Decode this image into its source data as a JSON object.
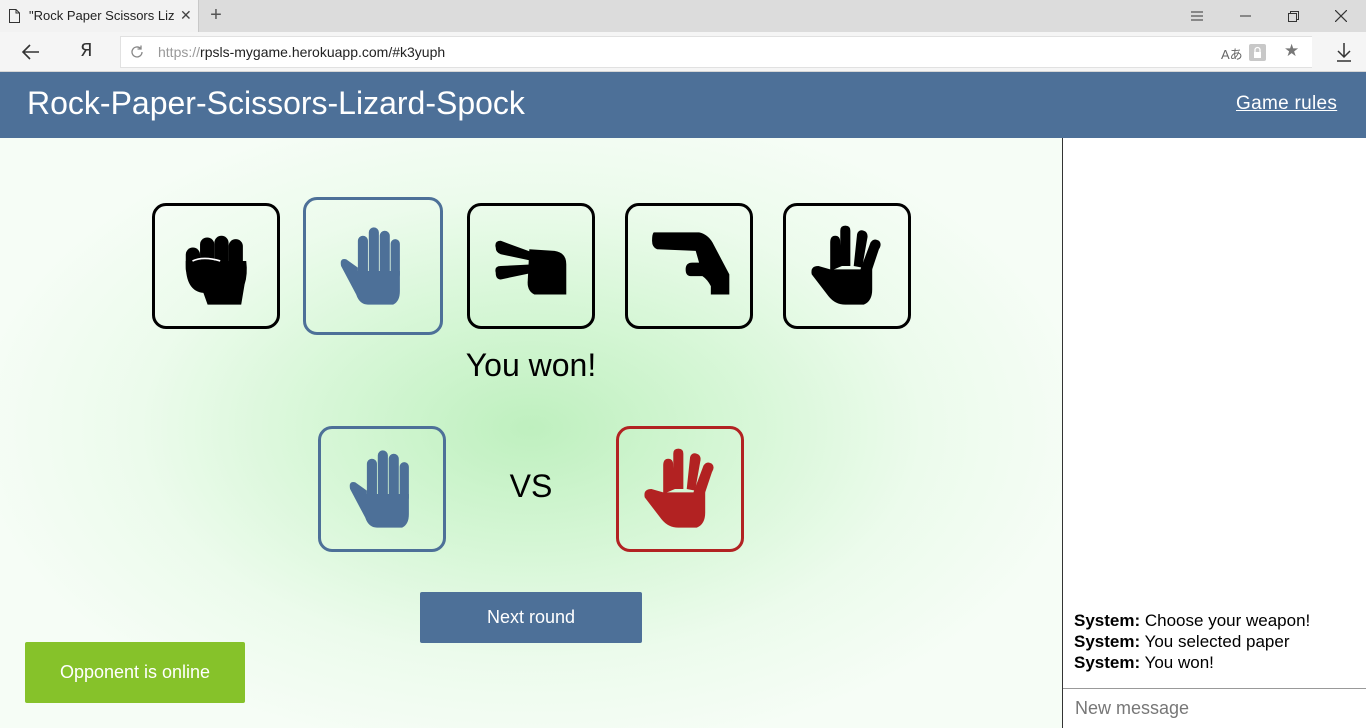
{
  "browser": {
    "tab_title": "\"Rock Paper Scissors Lizard",
    "tab_close": "✕",
    "new_tab": "+",
    "url_scheme": "https://",
    "url_rest": "rpsls-mygame.herokuapp.com/#k3yuph",
    "yandex_button": "Я",
    "translate_label": "Aあ",
    "star": "★"
  },
  "header": {
    "title": "Rock-Paper-Scissors-Lizard-Spock",
    "rules_link": "Game rules"
  },
  "weapons": [
    {
      "name": "rock",
      "selected": false
    },
    {
      "name": "paper",
      "selected": true
    },
    {
      "name": "scissors",
      "selected": false
    },
    {
      "name": "lizard",
      "selected": false
    },
    {
      "name": "spock",
      "selected": false
    }
  ],
  "result": {
    "text": "You won!",
    "vs": "VS",
    "player_weapon": "paper",
    "opponent_weapon": "spock"
  },
  "colors": {
    "accent": "#4d7098",
    "opponent": "#b22222",
    "online": "#86c22a"
  },
  "next_round_label": "Next round",
  "opponent_status": "Opponent is online",
  "chat": {
    "messages": [
      {
        "sender": "System:",
        "text": "Choose your weapon!"
      },
      {
        "sender": "System:",
        "text": "You selected paper"
      },
      {
        "sender": "System:",
        "text": "You won!"
      }
    ],
    "input_placeholder": "New message"
  }
}
